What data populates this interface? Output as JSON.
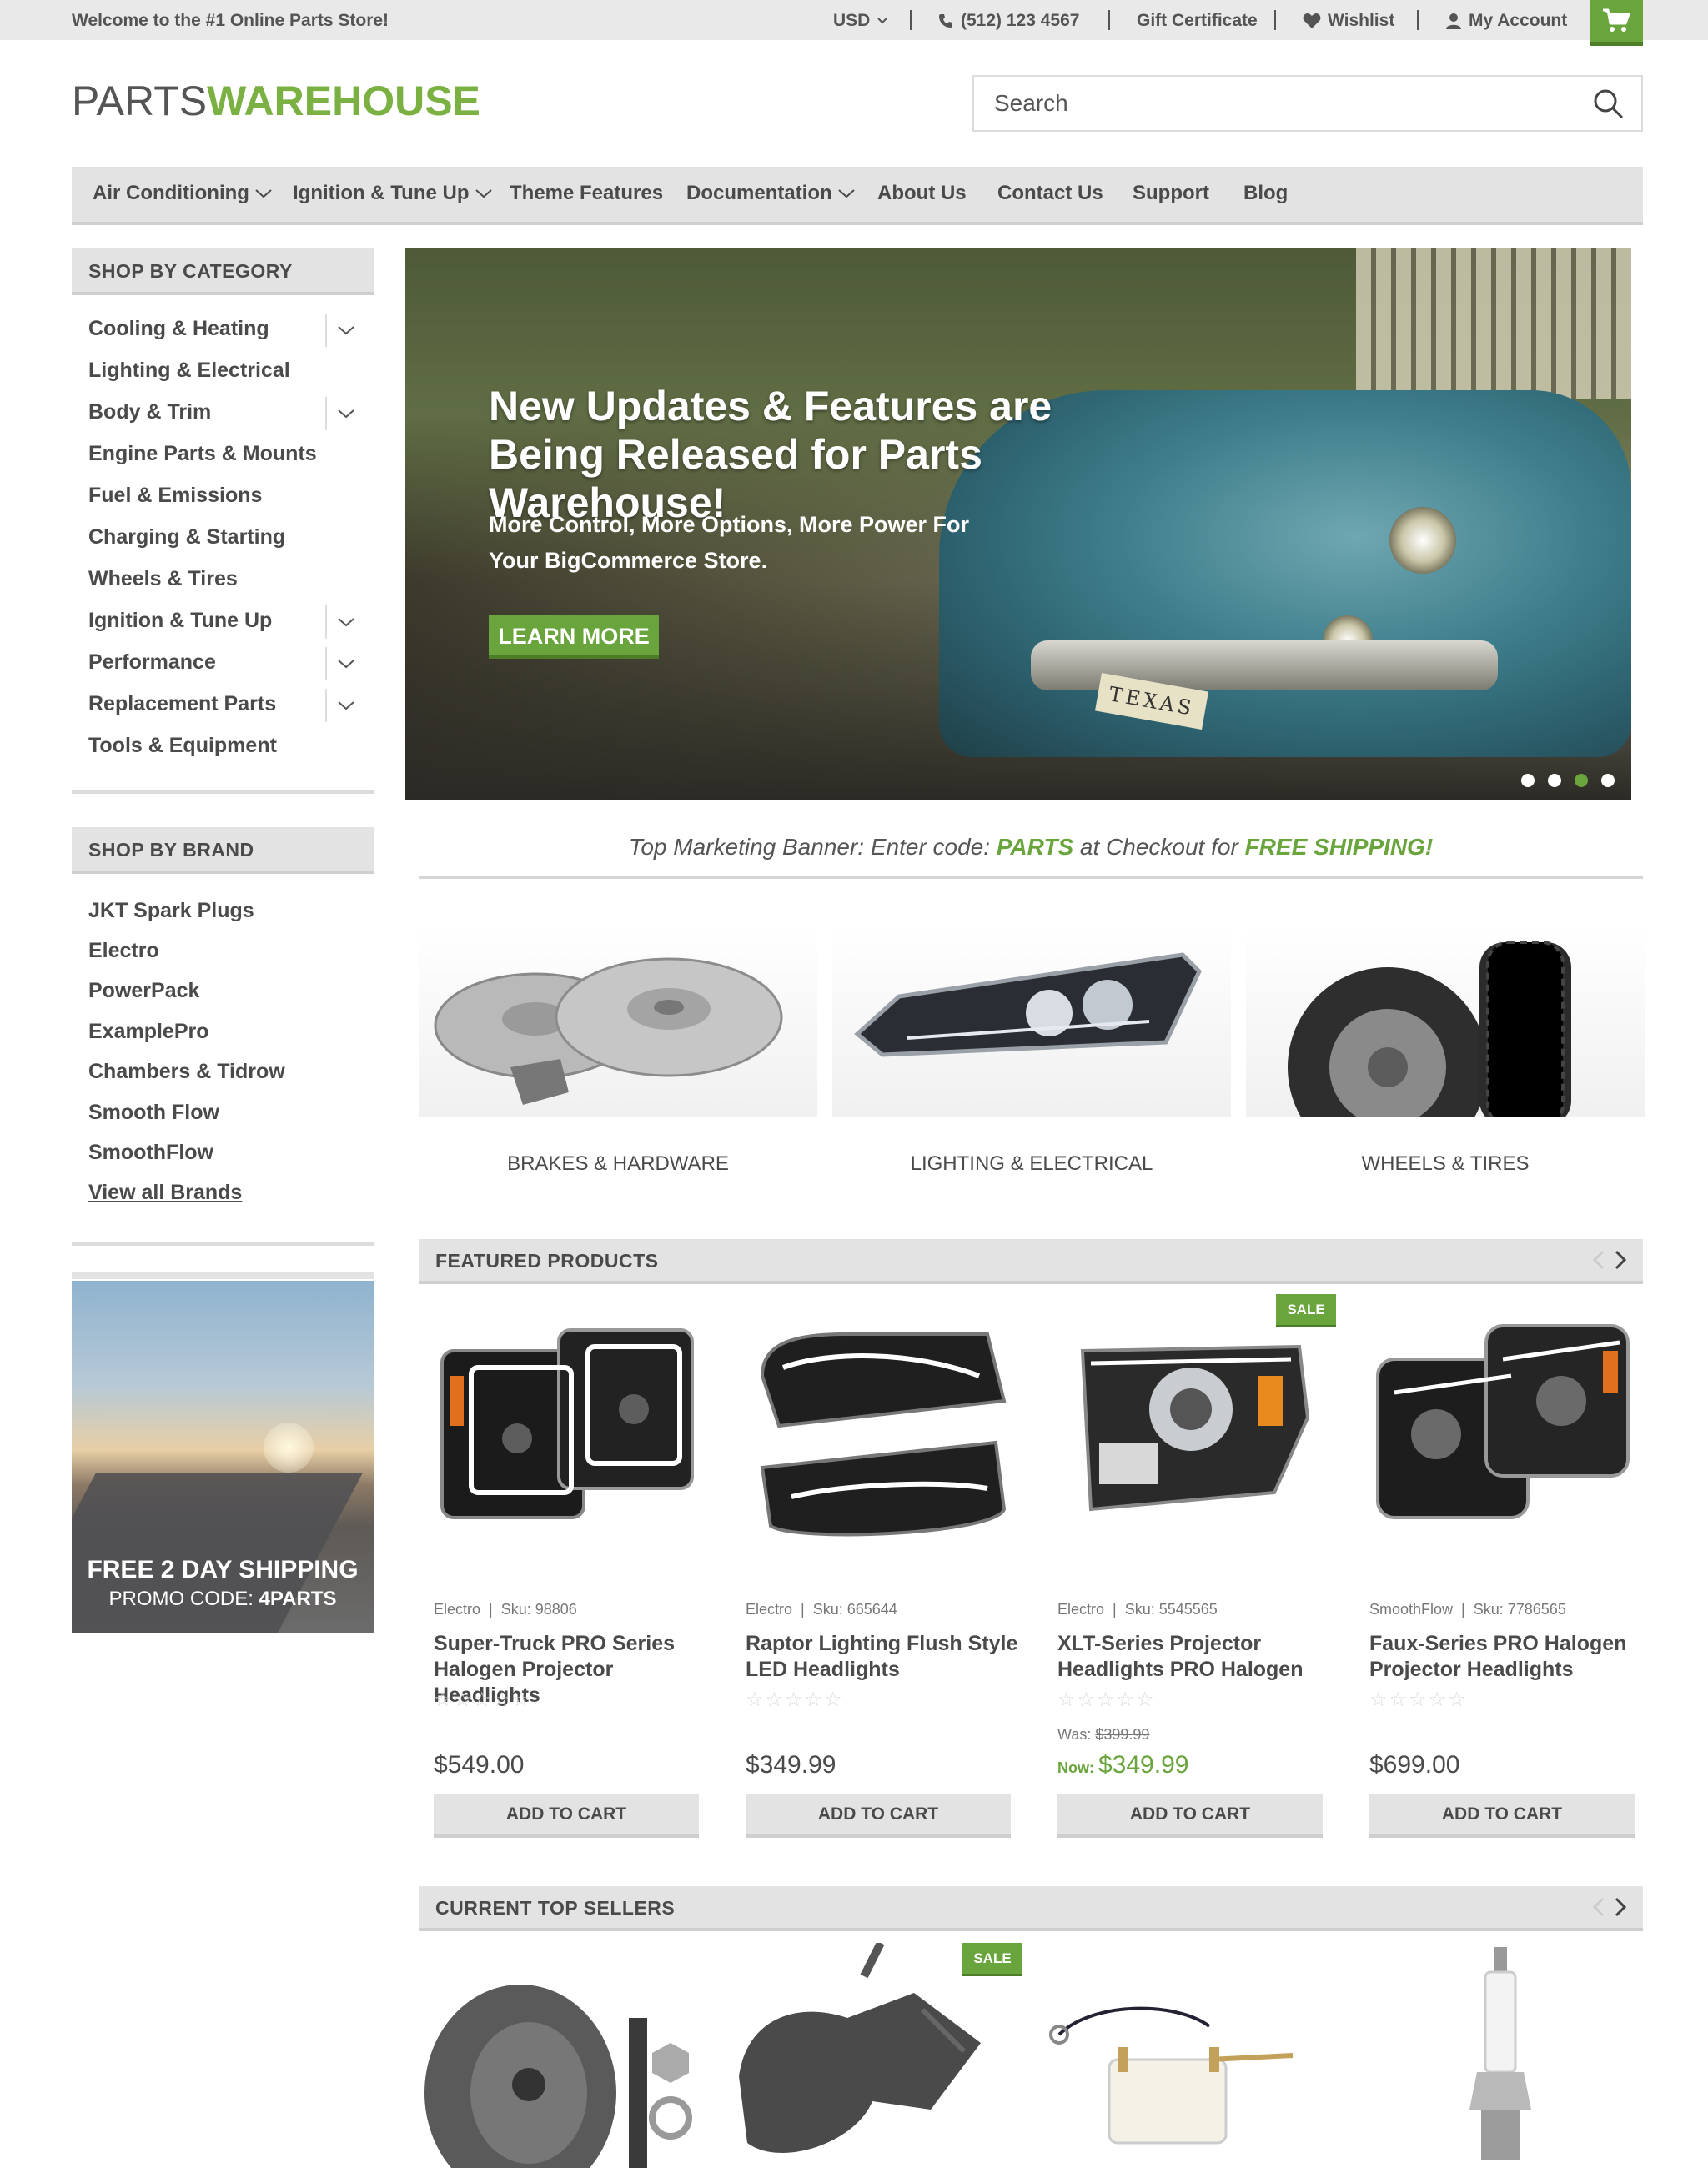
{
  "topbar": {
    "welcome": "Welcome to the #1 Online Parts Store!",
    "currency": "USD",
    "phone": "(512) 123 4567",
    "gift": "Gift Certificate",
    "wishlist": "Wishlist",
    "account": "My Account"
  },
  "logo": {
    "part1": "PARTS",
    "part2": "WAREHOUSE"
  },
  "search": {
    "placeholder": "Search"
  },
  "nav": [
    {
      "label": "Air Conditioning"
    },
    {
      "label": "Ignition & Tune Up"
    },
    {
      "label": "Theme Features"
    },
    {
      "label": "Documentation"
    },
    {
      "label": "About Us"
    },
    {
      "label": "Contact Us"
    },
    {
      "label": "Support"
    },
    {
      "label": "Blog"
    }
  ],
  "sidebar": {
    "category_heading": "SHOP BY CATEGORY",
    "categories": [
      "Cooling & Heating",
      "Lighting & Electrical",
      "Body & Trim",
      "Engine Parts & Mounts",
      "Fuel & Emissions",
      "Charging & Starting",
      "Wheels & Tires",
      "Ignition & Tune Up",
      "Performance",
      "Replacement Parts",
      "Tools & Equipment"
    ],
    "brand_heading": "SHOP BY BRAND",
    "brands": [
      "JKT Spark Plugs",
      "Electro",
      "PowerPack",
      "ExamplePro",
      "Chambers & Tidrow",
      "Smooth Flow",
      "SmoothFlow"
    ],
    "view_all": "View all Brands",
    "promo_line1": "FREE 2 DAY SHIPPING",
    "promo_line2_prefix": "PROMO CODE: ",
    "promo_code": "4PARTS"
  },
  "hero": {
    "title": "New Updates & Features are Being Released for Parts Warehouse!",
    "subtitle": "More Control, More Options, More Power For Your BigCommerce Store.",
    "button": "LEARN MORE",
    "plate": "TEXAS"
  },
  "marketing": {
    "prefix": "Top Marketing Banner: Enter code: ",
    "code": "PARTS",
    "middle": " at Checkout for ",
    "offer": "FREE SHIPPING!"
  },
  "tiles": [
    "BRAKES & HARDWARE",
    "LIGHTING & ELECTRICAL",
    "WHEELS & TIRES"
  ],
  "featured": {
    "heading": "FEATURED PRODUCTS",
    "products": [
      {
        "brand": "Electro",
        "sku": "Sku: 98806",
        "title": "Super-Truck PRO Series Halogen Projector Headlights",
        "price": "$549.00",
        "cart": "ADD TO CART"
      },
      {
        "brand": "Electro",
        "sku": "Sku: 665644",
        "title": "Raptor Lighting Flush Style LED Headlights",
        "price": "$349.99",
        "cart": "ADD TO CART"
      },
      {
        "brand": "Electro",
        "sku": "Sku: 5545565",
        "title": "XLT-Series Projector Headlights PRO Halogen",
        "was_label": "Was: ",
        "was": "$399.99",
        "now_label": "Now: ",
        "price": "$349.99",
        "cart": "ADD TO CART",
        "sale": "SALE"
      },
      {
        "brand": "SmoothFlow",
        "sku": "Sku: 7786565",
        "title": "Faux-Series PRO Halogen Projector Headlights",
        "price": "$699.00",
        "cart": "ADD TO CART"
      }
    ]
  },
  "top_sellers": {
    "heading": "CURRENT TOP SELLERS",
    "sale": "SALE"
  },
  "stars": "☆☆☆☆☆",
  "colors": {
    "accent": "#6aa43c",
    "logo_green": "#7bb043",
    "bar": "#e3e3e3",
    "text": "#4a4a4a"
  }
}
